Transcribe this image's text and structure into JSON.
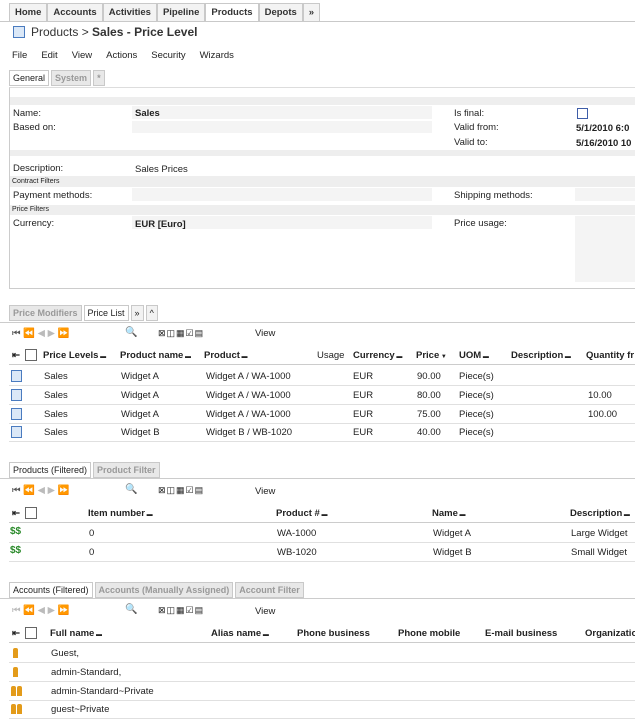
{
  "nav": {
    "tabs": [
      {
        "label": "Home",
        "active": false
      },
      {
        "label": "Accounts",
        "active": false
      },
      {
        "label": "Activities",
        "active": false
      },
      {
        "label": "Pipeline",
        "active": false
      },
      {
        "label": "Products",
        "active": true
      },
      {
        "label": "Depots",
        "active": false
      },
      {
        "label": "»",
        "active": false
      }
    ]
  },
  "title": {
    "prefix": "Products >",
    "name": "Sales - Price Level"
  },
  "menu": [
    "File",
    "Edit",
    "View",
    "Actions",
    "Security",
    "Wizards"
  ],
  "form_tabs": [
    "General",
    "System",
    "*"
  ],
  "form": {
    "name_label": "Name:",
    "name_value": "Sales",
    "based_on_label": "Based on:",
    "is_final_label": "Is final:",
    "valid_from_label": "Valid from:",
    "valid_from_value": "5/1/2010 6:0",
    "valid_to_label": "Valid to:",
    "valid_to_value": "5/16/2010 10",
    "description_label": "Description:",
    "description_value": "Sales Prices",
    "contract_filters_label": "Contract Filters",
    "payment_methods_label": "Payment methods:",
    "shipping_methods_label": "Shipping methods:",
    "price_filters_label": "Price Filters",
    "currency_label": "Currency:",
    "currency_value": "EUR [Euro]",
    "price_usage_label": "Price usage:"
  },
  "price_tabs": [
    "Price Modifiers",
    "Price List",
    "»",
    "^"
  ],
  "toolbar_view": "View",
  "price_list": {
    "columns": [
      "Price Levels",
      "Product name",
      "Product",
      "Usage",
      "Currency",
      "Price",
      "UOM",
      "Description",
      "Quantity fr"
    ],
    "rows": [
      [
        "Sales",
        "Widget A",
        "Widget A / WA-1000",
        "",
        "EUR",
        "90.00",
        "Piece(s)",
        "",
        ""
      ],
      [
        "Sales",
        "Widget A",
        "Widget A / WA-1000",
        "",
        "EUR",
        "80.00",
        "Piece(s)",
        "",
        "10.00"
      ],
      [
        "Sales",
        "Widget A",
        "Widget A / WA-1000",
        "",
        "EUR",
        "75.00",
        "Piece(s)",
        "",
        "100.00"
      ],
      [
        "Sales",
        "Widget B",
        "Widget B / WB-1020",
        "",
        "EUR",
        "40.00",
        "Piece(s)",
        "",
        ""
      ]
    ]
  },
  "products_tabs": [
    "Products (Filtered)",
    "Product Filter"
  ],
  "products": {
    "columns": [
      "Item number",
      "Product #",
      "Name",
      "Description"
    ],
    "rows": [
      [
        "0",
        "WA-1000",
        "Widget A",
        "Large Widget"
      ],
      [
        "0",
        "WB-1020",
        "Widget B",
        "Small Widget"
      ]
    ]
  },
  "accounts_tabs": [
    "Accounts (Filtered)",
    "Accounts (Manually Assigned)",
    "Account Filter"
  ],
  "accounts": {
    "columns": [
      "Full name",
      "Alias name",
      "Phone business",
      "Phone mobile",
      "E-mail business",
      "Organizatio"
    ],
    "rows": [
      [
        "Guest,"
      ],
      [
        "admin-Standard,"
      ],
      [
        "admin-Standard~Private"
      ],
      [
        "guest~Private"
      ]
    ]
  },
  "colors": {
    "accent": "#3e5da8",
    "icon_orange": "#e39b1a",
    "icon_green": "#2a8a2a"
  }
}
